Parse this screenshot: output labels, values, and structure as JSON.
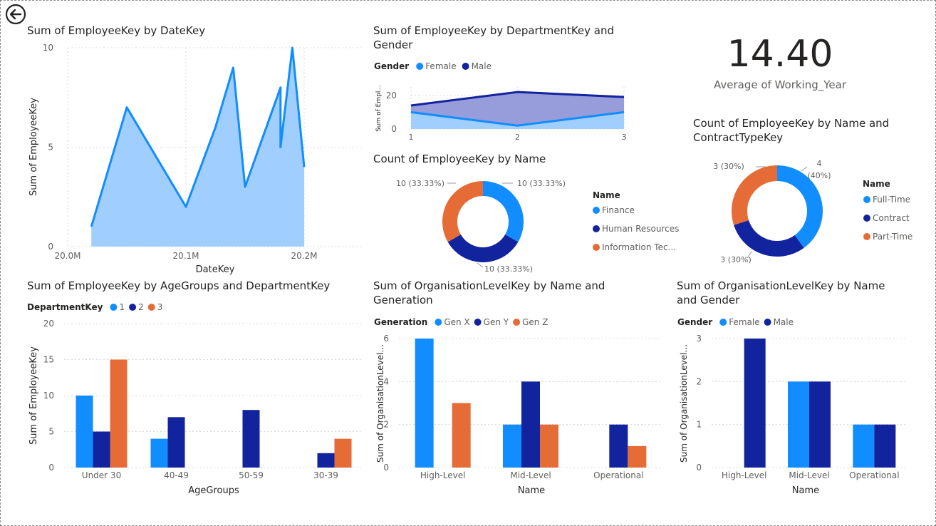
{
  "colors": {
    "light_blue": "#118DFF",
    "dark_blue": "#12239E",
    "orange": "#E66C37",
    "area_fill": "#A0CFFF",
    "grid": "#d8d8d8",
    "text": "#252423",
    "subtext": "#605e5c"
  },
  "back_button": {
    "icon": "back-arrow-icon"
  },
  "kpi": {
    "value": "14.40",
    "label": "Average of Working_Year"
  },
  "chart_data": [
    {
      "id": "date_area",
      "type": "area",
      "title": "Sum of EmployeeKey by DateKey",
      "xlabel": "DateKey",
      "ylabel": "Sum of EmployeeKey",
      "x_ticks": [
        "20.0M",
        "20.1M",
        "20.2M"
      ],
      "y_ticks": [
        "0",
        "5",
        "10"
      ],
      "ylim": [
        0,
        10
      ],
      "xlim": [
        20000000,
        20250000
      ],
      "grid": true,
      "points": [
        {
          "x": 20020000,
          "y": 1
        },
        {
          "x": 20050000,
          "y": 7
        },
        {
          "x": 20100000,
          "y": 2
        },
        {
          "x": 20125000,
          "y": 6
        },
        {
          "x": 20140000,
          "y": 9
        },
        {
          "x": 20150000,
          "y": 3
        },
        {
          "x": 20180000,
          "y": 8
        },
        {
          "x": 20180000,
          "y": 5
        },
        {
          "x": 20190000,
          "y": 10
        },
        {
          "x": 20200000,
          "y": 4
        }
      ]
    },
    {
      "id": "dept_gender_area",
      "type": "area",
      "title": "Sum of EmployeeKey by DepartmentKey and Gender",
      "title_lines": [
        "Sum of EmployeeKey by DepartmentKey and",
        "Gender"
      ],
      "legend_title": "Gender",
      "ylabel": "Sum of Empl...",
      "categories": [
        "1",
        "2",
        "3"
      ],
      "y_ticks": [
        "0",
        "20"
      ],
      "ylim": [
        0,
        25
      ],
      "grid": true,
      "series": [
        {
          "name": "Female",
          "color": "#118DFF",
          "values": [
            10,
            2,
            10
          ]
        },
        {
          "name": "Male",
          "color": "#12239E",
          "values": [
            14,
            22,
            19
          ]
        }
      ]
    },
    {
      "id": "name_donut",
      "type": "pie",
      "donut": true,
      "title": "Count of EmployeeKey by Name",
      "legend_title": "Name",
      "slices": [
        {
          "name": "Finance",
          "value": 10,
          "label": "10 (33.33%)",
          "color": "#118DFF"
        },
        {
          "name": "Human Resources",
          "value": 10,
          "label": "10 (33.33%)",
          "color": "#12239E"
        },
        {
          "name": "Information Tec...",
          "value": 10,
          "label": "10 (33.33%)",
          "color": "#E66C37"
        }
      ]
    },
    {
      "id": "contract_donut",
      "type": "pie",
      "donut": true,
      "title": "Count of EmployeeKey by Name and ContractTypeKey",
      "title_lines": [
        "Count of EmployeeKey by Name and",
        "ContractTypeKey"
      ],
      "legend_title": "Name",
      "slices": [
        {
          "name": "Full-Time",
          "value": 4,
          "label_lines": [
            "4",
            "(40%)"
          ],
          "color": "#118DFF"
        },
        {
          "name": "Contract",
          "value": 3,
          "label_lines": [
            "3 (30%)"
          ],
          "color": "#12239E"
        },
        {
          "name": "Part-Time",
          "value": 3,
          "label_lines": [
            "3 (30%)"
          ],
          "color": "#E66C37"
        }
      ]
    },
    {
      "id": "age_bar",
      "type": "bar",
      "title": "Sum of EmployeeKey by AgeGroups and DepartmentKey",
      "legend_title": "DepartmentKey",
      "xlabel": "AgeGroups",
      "ylabel": "Sum of EmployeeKey",
      "categories": [
        "Under 30",
        "40-49",
        "50-59",
        "30-39"
      ],
      "y_ticks": [
        "0",
        "5",
        "10",
        "15",
        "20"
      ],
      "ylim": [
        0,
        20
      ],
      "grid": true,
      "series": [
        {
          "name": "1",
          "color": "#118DFF",
          "values": [
            10,
            4,
            null,
            null
          ]
        },
        {
          "name": "2",
          "color": "#12239E",
          "values": [
            5,
            7,
            8,
            2
          ]
        },
        {
          "name": "3",
          "color": "#E66C37",
          "values": [
            15,
            null,
            null,
            4
          ]
        }
      ]
    },
    {
      "id": "gen_bar",
      "type": "bar",
      "title": "Sum of OrganisationLevelKey by Name and Generation",
      "title_lines": [
        "Sum of OrganisationLevelKey by Name and",
        "Generation"
      ],
      "legend_title": "Generation",
      "xlabel": "Name",
      "ylabel": "Sum of OrganisationLevel...",
      "categories": [
        "High-Level",
        "Mid-Level",
        "Operational"
      ],
      "y_ticks": [
        "0",
        "2",
        "4",
        "6"
      ],
      "ylim": [
        0,
        6
      ],
      "grid": true,
      "series": [
        {
          "name": "Gen X",
          "color": "#118DFF",
          "values": [
            6,
            2,
            null
          ]
        },
        {
          "name": "Gen Y",
          "color": "#12239E",
          "values": [
            null,
            4,
            2
          ]
        },
        {
          "name": "Gen Z",
          "color": "#E66C37",
          "values": [
            3,
            2,
            1
          ]
        }
      ]
    },
    {
      "id": "gender_bar",
      "type": "bar",
      "title": "Sum of OrganisationLevelKey by Name and Gender",
      "title_lines": [
        "Sum of OrganisationLevelKey by Name",
        "and Gender"
      ],
      "legend_title": "Gender",
      "xlabel": "Name",
      "ylabel": "Sum of OrganisationLevel...",
      "categories": [
        "High-Level",
        "Mid-Level",
        "Operational"
      ],
      "y_ticks": [
        "0",
        "1",
        "2",
        "3"
      ],
      "ylim": [
        0,
        3
      ],
      "grid": true,
      "series": [
        {
          "name": "Female",
          "color": "#118DFF",
          "values": [
            null,
            2,
            1
          ]
        },
        {
          "name": "Male",
          "color": "#12239E",
          "values": [
            3,
            2,
            1
          ]
        }
      ]
    }
  ]
}
